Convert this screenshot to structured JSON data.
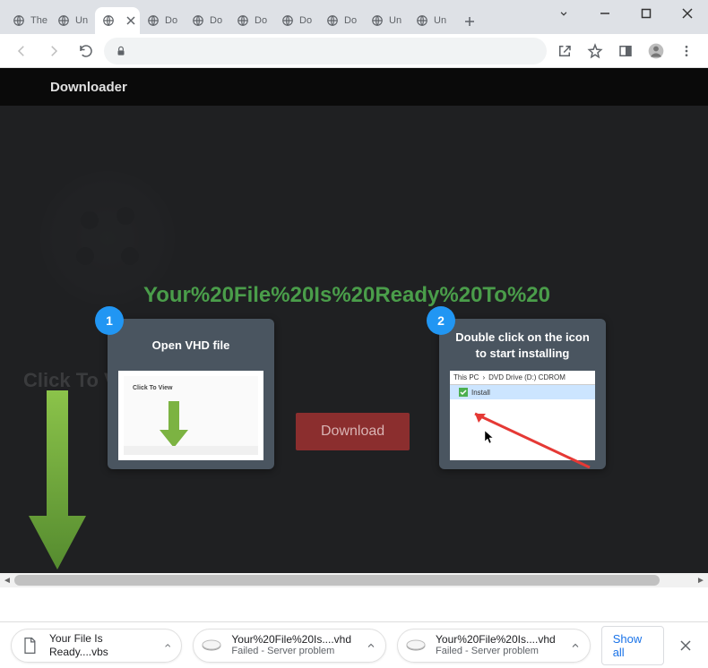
{
  "tabs": [
    {
      "label": "The"
    },
    {
      "label": "Un"
    },
    {
      "label": "",
      "active": true
    },
    {
      "label": "Do"
    },
    {
      "label": "Do"
    },
    {
      "label": "Do"
    },
    {
      "label": "Do"
    },
    {
      "label": "Do"
    },
    {
      "label": "Un"
    },
    {
      "label": "Un"
    }
  ],
  "page": {
    "header_title": "Downloader",
    "green_headline": "Your%20File%20Is%20Ready%20To%20",
    "click_to_view": "Click To View",
    "download_button": "Download",
    "step1": {
      "badge": "1",
      "title": "Open VHD file",
      "thumb_ctv": "Click To View"
    },
    "step2": {
      "badge": "2",
      "title": "Double click on the icon to start installing",
      "breadcrumb_a": "This PC",
      "breadcrumb_sep": "›",
      "breadcrumb_b": "DVD Drive (D:) CDROM",
      "install_label": "Install"
    }
  },
  "downloads": {
    "item1": {
      "name": "Your File Is Ready....vbs"
    },
    "item2": {
      "name": "Your%20File%20Is....vhd",
      "status": "Failed - Server problem"
    },
    "item3": {
      "name": "Your%20File%20Is....vhd",
      "status": "Failed - Server problem"
    },
    "show_all": "Show all"
  }
}
